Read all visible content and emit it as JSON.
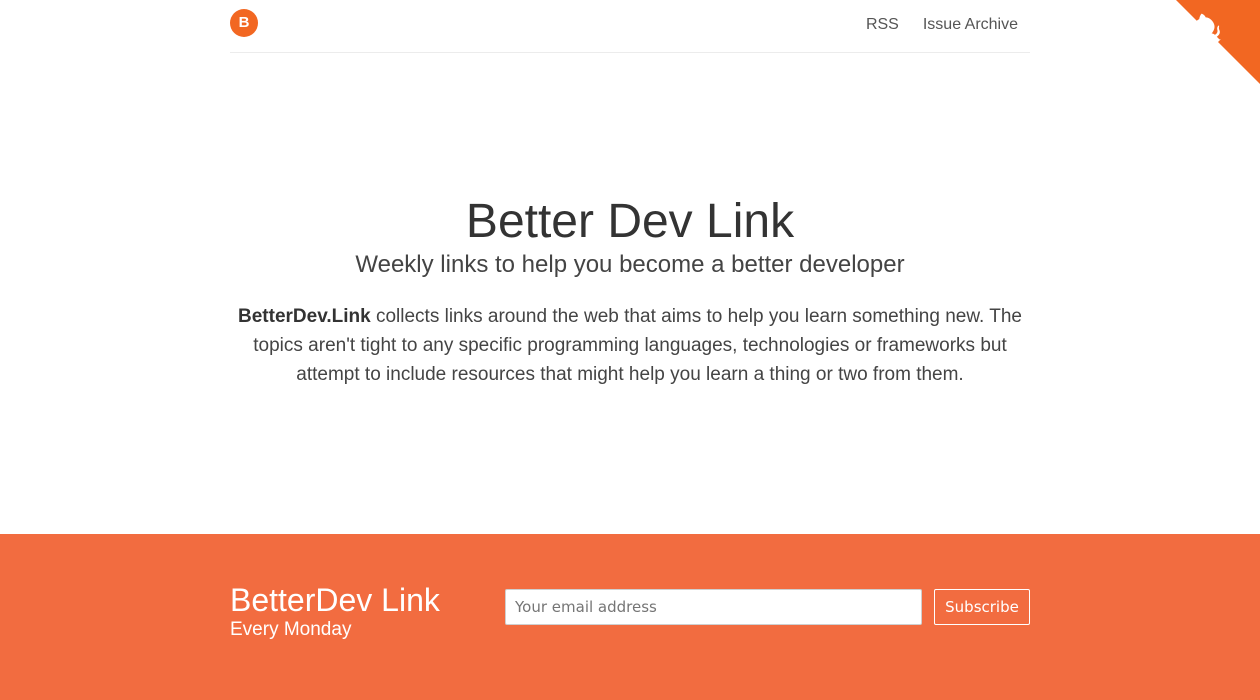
{
  "header": {
    "logo_letter": "B",
    "nav": [
      {
        "label": "RSS"
      },
      {
        "label": "Issue Archive"
      }
    ]
  },
  "corner": {
    "icon": "github-octocat-icon",
    "color": "#f26722"
  },
  "hero": {
    "title": "Better Dev Link",
    "subtitle": "Weekly links to help you become a better developer",
    "description_brand": "BetterDev.Link",
    "description_rest": " collects links around the web that aims to help you learn something new. The topics aren't tight to any specific programming languages, technologies or frameworks but attempt to include resources that might help you learn a thing or two from them."
  },
  "footer": {
    "background": "#f26c40",
    "title": "BetterDev Link",
    "subtitle": "Every Monday",
    "email_placeholder": "Your email address",
    "email_value": "",
    "subscribe_label": "Subscribe"
  }
}
